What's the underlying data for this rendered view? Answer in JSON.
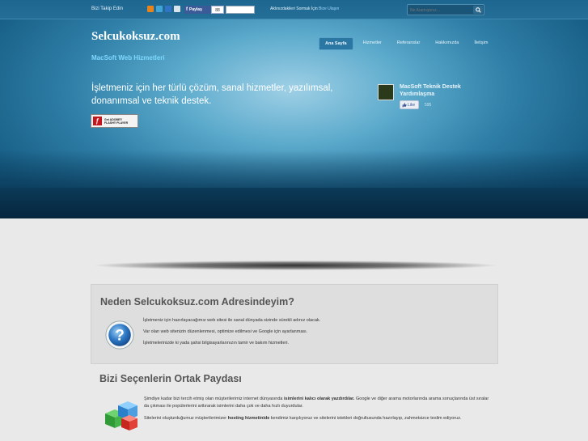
{
  "topbar": {
    "follow_label": "Bizi Takip Edin",
    "social_icons": [
      "rss-icon",
      "twitter-icon",
      "delicious-icon",
      "digg-icon"
    ],
    "share_label": "Paylaş",
    "share_count": "88",
    "message_prefix": "Aklınızdakileri Sormak İçin",
    "message_link": "Bize Ulaşın",
    "search_placeholder": "Ne Aramıştınız..."
  },
  "header": {
    "brand": "Selcukoksuz.com",
    "tagline": "MacSoft Web Hizmetleri",
    "nav": [
      {
        "label": "Ana Sayfa",
        "active": true
      },
      {
        "label": "Hizmetler",
        "active": false
      },
      {
        "label": "Referanslar",
        "active": false
      },
      {
        "label": "Hakkımızda",
        "active": false
      },
      {
        "label": "İletişim",
        "active": false
      }
    ],
    "headline_line1": "İşletmeniz için her türlü çözüm, sanal hizmetler, yazılımsal,",
    "headline_line2": "donanımsal ve teknik destek.",
    "flash_text_1": "Get ADOBE®",
    "flash_text_2": "FLASH® PLAYER"
  },
  "facebook": {
    "page_name": "MacSoft Teknik Destek Yardımlaşma",
    "like_label": "Like",
    "like_count": "595"
  },
  "section1": {
    "title": "Neden Selcukoksuz.com Adresindeyim?",
    "lines": [
      "İşletmeniz için hazırlayacağımız web sitesi ile sanal dünyada sizinde sürekli adınız olacak.",
      "Var olan web sitenizin düzenlenmesi, optimize edilmesi ve Google için ayarlanması.",
      "İşletmelerinizde ki yada şahsi bilgisayarlarınızın tamir ve bakım hizmetleri."
    ]
  },
  "section2": {
    "title": "Bizi Seçenlerin Ortak Paydası",
    "p1_a": "Şimdiye kadar bizi tercih etmiş olan müşterilerimiz internet dünyasında ",
    "p1_b": "isimlerini kalıcı olarak yazdırdılar.",
    "p1_c": " Google ve diğer arama motorlarında arama sonuçlarında üst sıralar da çıkması ile popülerlerini arttırarak isimlerini daha çok ve daha hızlı duyurdular.",
    "p2_a": "Sitelerini oluşturduğumuz müşterilerimizer ",
    "p2_b": "hosting hizmetinide",
    "p2_c": " kendimiz karşılıyoruz ve sitelerini istekleri doğrultusunda hazırlayıp, zahmetsizce teslim ediyoruz."
  },
  "colors": {
    "hero": "#2f7fa8",
    "accent_link": "#9fd6ff",
    "tagline": "#7ed9ff",
    "page_bg": "#e9e9e9"
  }
}
